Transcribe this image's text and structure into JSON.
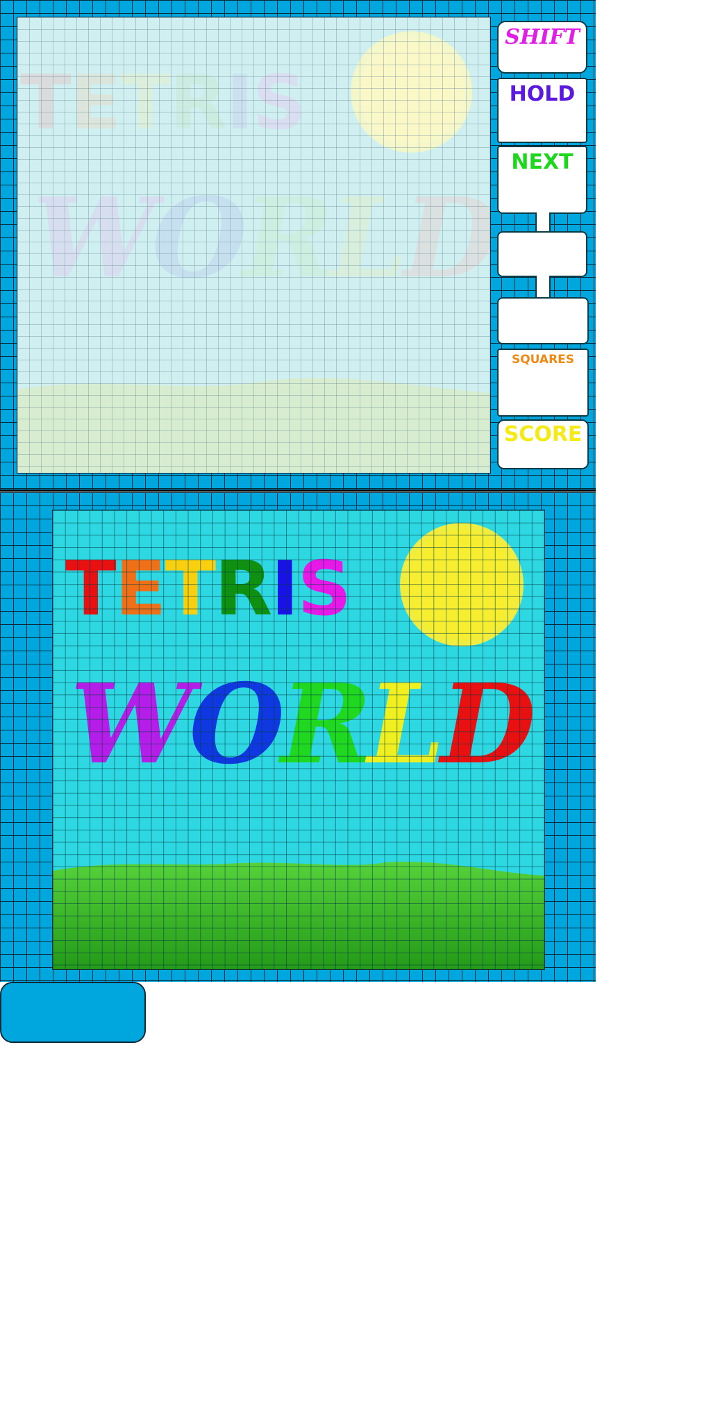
{
  "game": {
    "title_word_1": [
      "T",
      "E",
      "T",
      "R",
      "I",
      "S"
    ],
    "title_word_2": [
      "W",
      "O",
      "R",
      "L",
      "D"
    ],
    "title_colors_1": [
      "#e81010",
      "#f07018",
      "#f8d010",
      "#109010",
      "#1a10e8",
      "#e818e8"
    ],
    "title_colors_2": [
      "#b41ee8",
      "#1038e0",
      "#20d820",
      "#f0f020",
      "#e81010"
    ],
    "title_colors_faded_1": [
      "#f6b0b0",
      "#f8d0b0",
      "#f8f0b0",
      "#c8e8c0",
      "#c8c0f0",
      "#f0b8f0"
    ],
    "title_colors_faded_2": [
      "#e8b8f0",
      "#b8c0f0",
      "#c8f0c0",
      "#f0f0b8",
      "#f8c0c0"
    ]
  },
  "sidebar": {
    "shift_label": "SHIFT",
    "hold_label": "HOLD",
    "next_label": "NEXT",
    "squares_label": "SQUARES",
    "score_label": "SCORE"
  },
  "colors": {
    "tile": "#00a7df",
    "sky": "#2ed8e2",
    "grass": "#3ec02a",
    "sun": "#f6ee2e"
  },
  "icons": [
    "sun-graphic",
    "grass-hills-graphic"
  ]
}
